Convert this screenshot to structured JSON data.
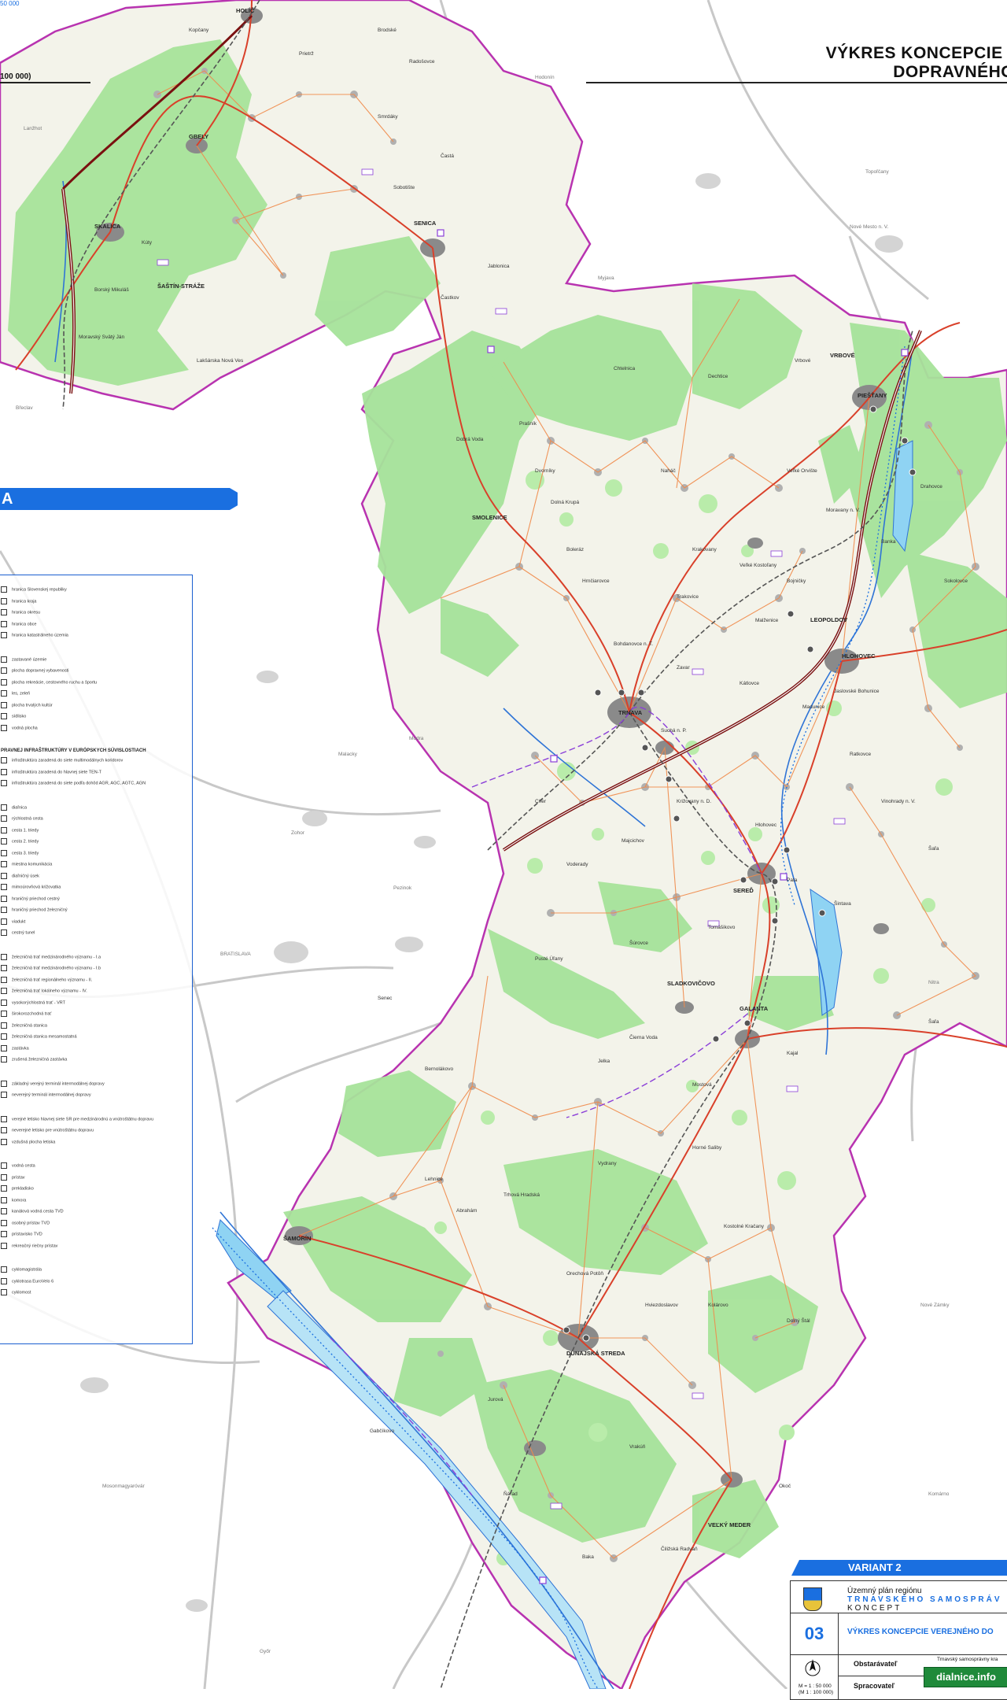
{
  "header": {
    "title": "VÝKRES KONCEPCIE VE\nDOPRAVNÉHO V",
    "scale_top": "100 000)",
    "scale_top_corner": "50 000"
  },
  "legend": {
    "banner": "A",
    "sections": [
      {
        "items": [
          "hranica Slovenskej republiky",
          "hranica kraja",
          "hranica okresu",
          "hranica obce",
          "hranica katastrálneho územia"
        ]
      },
      {
        "items": [
          "zastavané územie",
          "plocha dopravnej vybavenosti",
          "plocha rekreácie, cestovného ruchu a športu",
          "les, zeleň",
          "plocha trvalých kultúr",
          "sídlisko",
          "vodná plocha"
        ]
      },
      {
        "heading": "PRAVNEJ INFRAŠTRUKTÚRY V EURÓPSKYCH SÚVISLOSTIACH",
        "items": [
          "infraštruktúra zaradená do siete multimodálnych koridorov",
          "infraštruktúra zaradená do hlavnej siete TEN-T",
          "infraštruktúra zaradená do siete podľa dohôd AGR, AGC, AGTC, AGN"
        ]
      },
      {
        "items": [
          "diaľnica",
          "rýchlostná cesta",
          "cesta 1. triedy",
          "cesta 2. triedy",
          "cesta 3. triedy",
          "miestna komunikácia",
          "diaľničný úsek",
          "mimoúrovňová križovatka",
          "hraničný priechod cestný",
          "hraničný priechod železničný",
          "viadukt",
          "cestný tunel"
        ]
      },
      {
        "items": [
          "železničná trať medzinárodného významu - I.a",
          "železničná trať medzinárodného významu - I.b",
          "železničná trať regionálneho významu - II.",
          "železničná trať lokálneho významu - IV.",
          "vysokorýchlostná trať - VRT",
          "širokorozchodná trať",
          "železničná stanica",
          "železničná stanica mesamostatná",
          "zastávka",
          "zrušená železničná zastávka"
        ]
      },
      {
        "items": [
          "základný verejný terminál intermodálnej dopravy",
          "neverejný terminál intermodálnej dopravy"
        ]
      },
      {
        "items": [
          "verejné letisko hlavnej siete SR pre medzinárodnú a vnútroštátnu dopravu",
          "neverejné letisko pre vnútroštátnu dopravu",
          "vzdušná plocha letiska"
        ]
      },
      {
        "items": [
          "vodná cesta",
          "prístav",
          "prekladisko",
          "komora",
          "kanálová vodná cesta TVD",
          "osobný prístav TVD",
          "prístavisko TVD",
          "rekreačný riečny prístav"
        ]
      },
      {
        "items": [
          "cyklomagistrála",
          "cyklotrasa EuroVelo 6",
          "cyklomost"
        ]
      }
    ]
  },
  "map": {
    "towns_major": [
      "HOLÍČ",
      "GBELY",
      "SKALICA",
      "ŠAŠTÍN-STRÁŽE",
      "SENICA",
      "PIEŠŤANY",
      "VRBOVÉ",
      "HLOHOVEC",
      "TRNAVA",
      "SEREĎ",
      "GALANTA",
      "SLADKOVIČOVO",
      "DUNAJSKÁ STREDA",
      "ŠAMORÍN",
      "VEĽKÝ MEDER",
      "LEOPOLDOV",
      "SMOLENICE"
    ],
    "towns_minor": [
      "Kopčany",
      "Prietrž",
      "Kúty",
      "Radošovce",
      "Smrdáky",
      "Častá",
      "Brodské",
      "Sobotište",
      "Jablonica",
      "Častkov",
      "Moravský Svätý Ján",
      "Borský Mikuláš",
      "Lakšárska Nová Ves",
      "Chtelnica",
      "Dechtice",
      "Dolná Krupá",
      "Boleráz",
      "Bohdanovce n. T.",
      "Zavar",
      "Cífer",
      "Voderady",
      "Majcichov",
      "Križovany n. D.",
      "Pata",
      "Šintava",
      "Tomášikovo",
      "Mostová",
      "Jelka",
      "Čierna Voda",
      "Šaľa",
      "Senec",
      "Bernolákovo",
      "Gabčíkovo",
      "Dolný Štál",
      "Kolárovo",
      "Okoč",
      "Trhová Hradská",
      "Lehnice",
      "Hviezdoslavov",
      "Orechová Potôň",
      "Vrakúň",
      "Čiližská Radvaň",
      "Ňárad",
      "Jurová",
      "Baka",
      "Kostolné Kračany",
      "Vydrany",
      "Horné Saliby",
      "Kajal",
      "Abrahám",
      "Pusté Úľany",
      "Šúrovce",
      "Madunice",
      "Ratkovce",
      "Veľké Orvište",
      "Moravany n. V.",
      "Banka",
      "Drahovce",
      "Sokolovce",
      "Veľké Kostoľany",
      "Krakovany",
      "Trakovice",
      "Hrnčiarovce",
      "Suchá n. P.",
      "Malženice",
      "Bojničky",
      "Dvorníky",
      "Vinohrady n. V.",
      "Šaľa",
      "Hlohovec",
      "Jaslovské Bohunice",
      "Kátlovce",
      "Naháč",
      "Dobrá Voda",
      "Prašník",
      "Vrbové"
    ],
    "neighbours": [
      "BRATISLAVA",
      "Lanžhot",
      "Malacky",
      "Zohor",
      "Pezinok",
      "Modra",
      "Nitra",
      "Nové Zámky",
      "Topoľčany",
      "Nové Mesto n. V.",
      "Myjava",
      "Břeclav",
      "Hodonín",
      "Mosonmagyaróvár",
      "Győr",
      "Komárno"
    ]
  },
  "title_block": {
    "variant": "VARIANT 2",
    "line1": "Územný plán regiónu",
    "line2": "TRNAVSKÉHO SAMOSPRÁV",
    "line3": "KONCEPT",
    "number": "03",
    "doc_title": "VÝKRES KONCEPCIE VEREJNÉHO DO",
    "obstaravatel_label": "Obstarávateľ",
    "obstaravatel_value": "Trnavský samosprávny kra",
    "spracovatel_label": "Spracovateľ",
    "scale": "M = 1 : 50 000\n(M 1 : 100 000)"
  },
  "watermark": "dialnice.info",
  "colors": {
    "forest": "#a6e39a",
    "urban": "#8a8a8a",
    "region_border": "#b833b0",
    "motorway": "#7a1010",
    "road_major": "#d9402a",
    "road_minor": "#f08a4a",
    "rail": "#555555",
    "water": "#2f74d6",
    "accent": "#1a6fe0"
  }
}
